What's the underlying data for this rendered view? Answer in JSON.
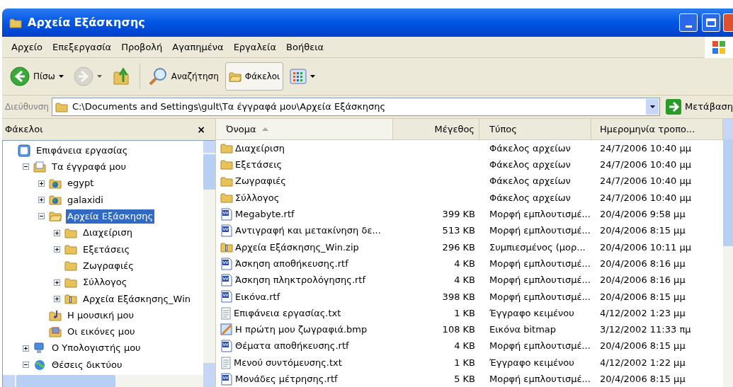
{
  "window": {
    "title": "Αρχεία Εξάσκησης"
  },
  "menu": [
    "Αρχείο",
    "Επεξεργασία",
    "Προβολή",
    "Αγαπημένα",
    "Εργαλεία",
    "Βοήθεια"
  ],
  "toolbar": [
    {
      "kind": "back",
      "label": "Πίσω",
      "disabled": false,
      "selected": false
    },
    {
      "kind": "forward",
      "disabled": true,
      "selected": false
    },
    {
      "kind": "up",
      "disabled": false,
      "selected": false
    },
    {
      "kind": "search",
      "label": "Αναζήτηση",
      "disabled": false,
      "selected": false
    },
    {
      "kind": "folders",
      "label": "Φάκελοι",
      "disabled": false,
      "selected": true
    },
    {
      "kind": "views",
      "disabled": false,
      "selected": false
    }
  ],
  "address": {
    "label": "Διεύθυνση",
    "value": "C:\\Documents and Settings\\gult\\Τα έγγραφά μου\\Αρχεία Εξάσκησης",
    "go": "Μετάβαση"
  },
  "folders_pane": {
    "title": "Φάκελοι",
    "close": "×",
    "tree": [
      {
        "label": "Επιφάνεια εργασίας",
        "kind": "desktop",
        "selected": false,
        "children": [
          {
            "label": "Τα έγγραφά μου",
            "kind": "documents",
            "expanded": true,
            "selected": false,
            "children": [
              {
                "label": "egypt",
                "kind": "webfolder",
                "expanded": false,
                "selected": false
              },
              {
                "label": "galaxidi",
                "kind": "webfolder",
                "expanded": false,
                "selected": false
              },
              {
                "label": "Αρχεία Εξάσκησης",
                "kind": "openfolder",
                "expanded": true,
                "selected": true,
                "children": [
                  {
                    "label": "Διαχείριση",
                    "kind": "folder",
                    "expanded": false,
                    "selected": false
                  },
                  {
                    "label": "Εξετάσεις",
                    "kind": "folder",
                    "expanded": false,
                    "selected": false
                  },
                  {
                    "label": "Ζωγραφιές",
                    "kind": "folder",
                    "selected": false
                  },
                  {
                    "label": "Σύλλογος",
                    "kind": "folder",
                    "expanded": false,
                    "selected": false
                  },
                  {
                    "label": "Αρχεία Εξάσκησης_Win",
                    "kind": "zip",
                    "expanded": false,
                    "selected": false
                  }
                ]
              },
              {
                "label": "Η μουσική μου",
                "kind": "music",
                "selected": false
              },
              {
                "label": "Οι εικόνες μου",
                "kind": "pictures",
                "selected": false
              }
            ]
          },
          {
            "label": "Ο Υπολογιστής μου",
            "kind": "computer",
            "expanded": false,
            "selected": false
          },
          {
            "label": "Θέσεις δικτύου",
            "kind": "network",
            "expanded": true,
            "selected": false
          }
        ]
      }
    ]
  },
  "file_list": {
    "columns": [
      {
        "label": "Όνομα",
        "sorted": true
      },
      {
        "label": "Μέγεθος",
        "sorted": false
      },
      {
        "label": "Τύπος",
        "sorted": false
      },
      {
        "label": "Ημερομηνία τροπο...",
        "sorted": false
      }
    ],
    "rows": [
      {
        "kind": "folder",
        "name": "Διαχείριση",
        "type": "Φάκελος αρχείων",
        "date": "24/7/2006 10:40 μμ"
      },
      {
        "kind": "folder",
        "name": "Εξετάσεις",
        "type": "Φάκελος αρχείων",
        "date": "24/7/2006 10:40 μμ"
      },
      {
        "kind": "folder",
        "name": "Ζωγραφιές",
        "type": "Φάκελος αρχείων",
        "date": "24/7/2006 10:40 μμ"
      },
      {
        "kind": "folder",
        "name": "Σύλλογος",
        "type": "Φάκελος αρχείων",
        "date": "24/7/2006 10:40 μμ"
      },
      {
        "kind": "word",
        "name": "Megabyte.rtf",
        "size": "399 KB",
        "type": "Μορφή εμπλουτισμέ...",
        "date": "20/4/2006 9:58 μμ"
      },
      {
        "kind": "word",
        "name": "Αντιγραφή και μετακίνηση δε...",
        "size": "513 KB",
        "type": "Μορφή εμπλουτισμέ...",
        "date": "20/4/2006 8:15 μμ"
      },
      {
        "kind": "zip",
        "name": "Αρχεία Εξάσκησης_Win.zip",
        "size": "296 KB",
        "type": "Συμπιεσμένος (μορ...",
        "date": "20/4/2006 10:11 μμ"
      },
      {
        "kind": "word",
        "name": "Άσκηση αποθήκευσης.rtf",
        "size": "4 KB",
        "type": "Μορφή εμπλουτισμέ...",
        "date": "20/4/2006 8:16 μμ"
      },
      {
        "kind": "word",
        "name": "Άσκηση πληκτρολόγησης.rtf",
        "size": "4 KB",
        "type": "Μορφή εμπλουτισμέ...",
        "date": "20/4/2006 8:16 μμ"
      },
      {
        "kind": "word",
        "name": "Εικόνα.rtf",
        "size": "398 KB",
        "type": "Μορφή εμπλουτισμέ...",
        "date": "20/4/2006 8:15 μμ"
      },
      {
        "kind": "text",
        "name": "Επιφάνεια εργασίας.txt",
        "size": "1 KB",
        "type": "Έγγραφο κειμένου",
        "date": "4/12/2002 1:23 μμ"
      },
      {
        "kind": "bitmap",
        "name": "Η πρώτη μου ζωγραφιά.bmp",
        "size": "108 KB",
        "type": "Εικόνα bitmap",
        "date": "3/12/2002 11:33 πμ"
      },
      {
        "kind": "word",
        "name": "Θέματα αποθήκευσης.rtf",
        "size": "4 KB",
        "type": "Μορφή εμπλουτισμέ...",
        "date": "20/4/2006 8:15 μμ"
      },
      {
        "kind": "text",
        "name": "Μενού συντόμευσης.txt",
        "size": "1 KB",
        "type": "Έγγραφο κειμένου",
        "date": "4/12/2002 1:22 μμ"
      },
      {
        "kind": "word",
        "name": "Μονάδες μέτρησης.rtf",
        "size": "5 KB",
        "type": "Μορφή εμπλουτισμέ...",
        "date": "20/4/2006 8:15 μμ"
      }
    ]
  }
}
